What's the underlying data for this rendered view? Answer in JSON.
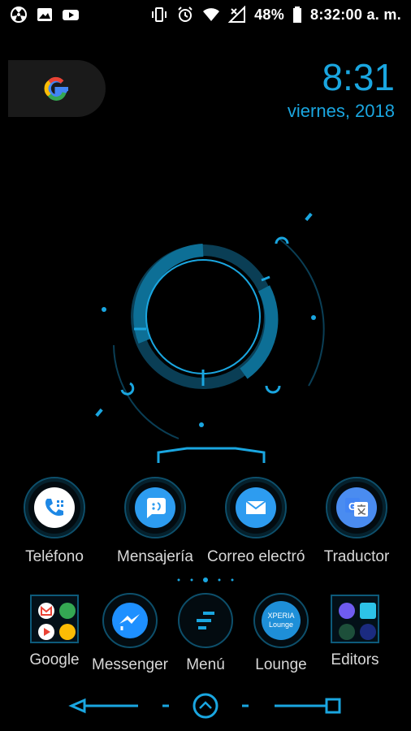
{
  "status": {
    "battery": "48%",
    "time": "8:32:00 a. m."
  },
  "clock": {
    "time": "8:31",
    "date": "viernes, 2018"
  },
  "google_widget": {
    "letter": "G"
  },
  "apps": [
    {
      "label": "Teléfono",
      "icon": "phone-icon"
    },
    {
      "label": "Mensajería",
      "icon": "message-icon"
    },
    {
      "label": "Correo electró",
      "icon": "email-icon"
    },
    {
      "label": "Traductor",
      "icon": "translate-icon"
    }
  ],
  "dock": [
    {
      "label": "Google",
      "icon": "google-folder-icon"
    },
    {
      "label": "Messenger",
      "icon": "messenger-icon"
    },
    {
      "label": "Menú",
      "icon": "menu-icon"
    },
    {
      "label": "Lounge",
      "icon": "lounge-icon",
      "badge": "XPERIA Lounge"
    },
    {
      "label": "Editors",
      "icon": "editors-folder-icon"
    }
  ],
  "colors": {
    "accent": "#1aa6e0",
    "hud": "#0d6f96",
    "hud_dark": "#0a3e55"
  }
}
